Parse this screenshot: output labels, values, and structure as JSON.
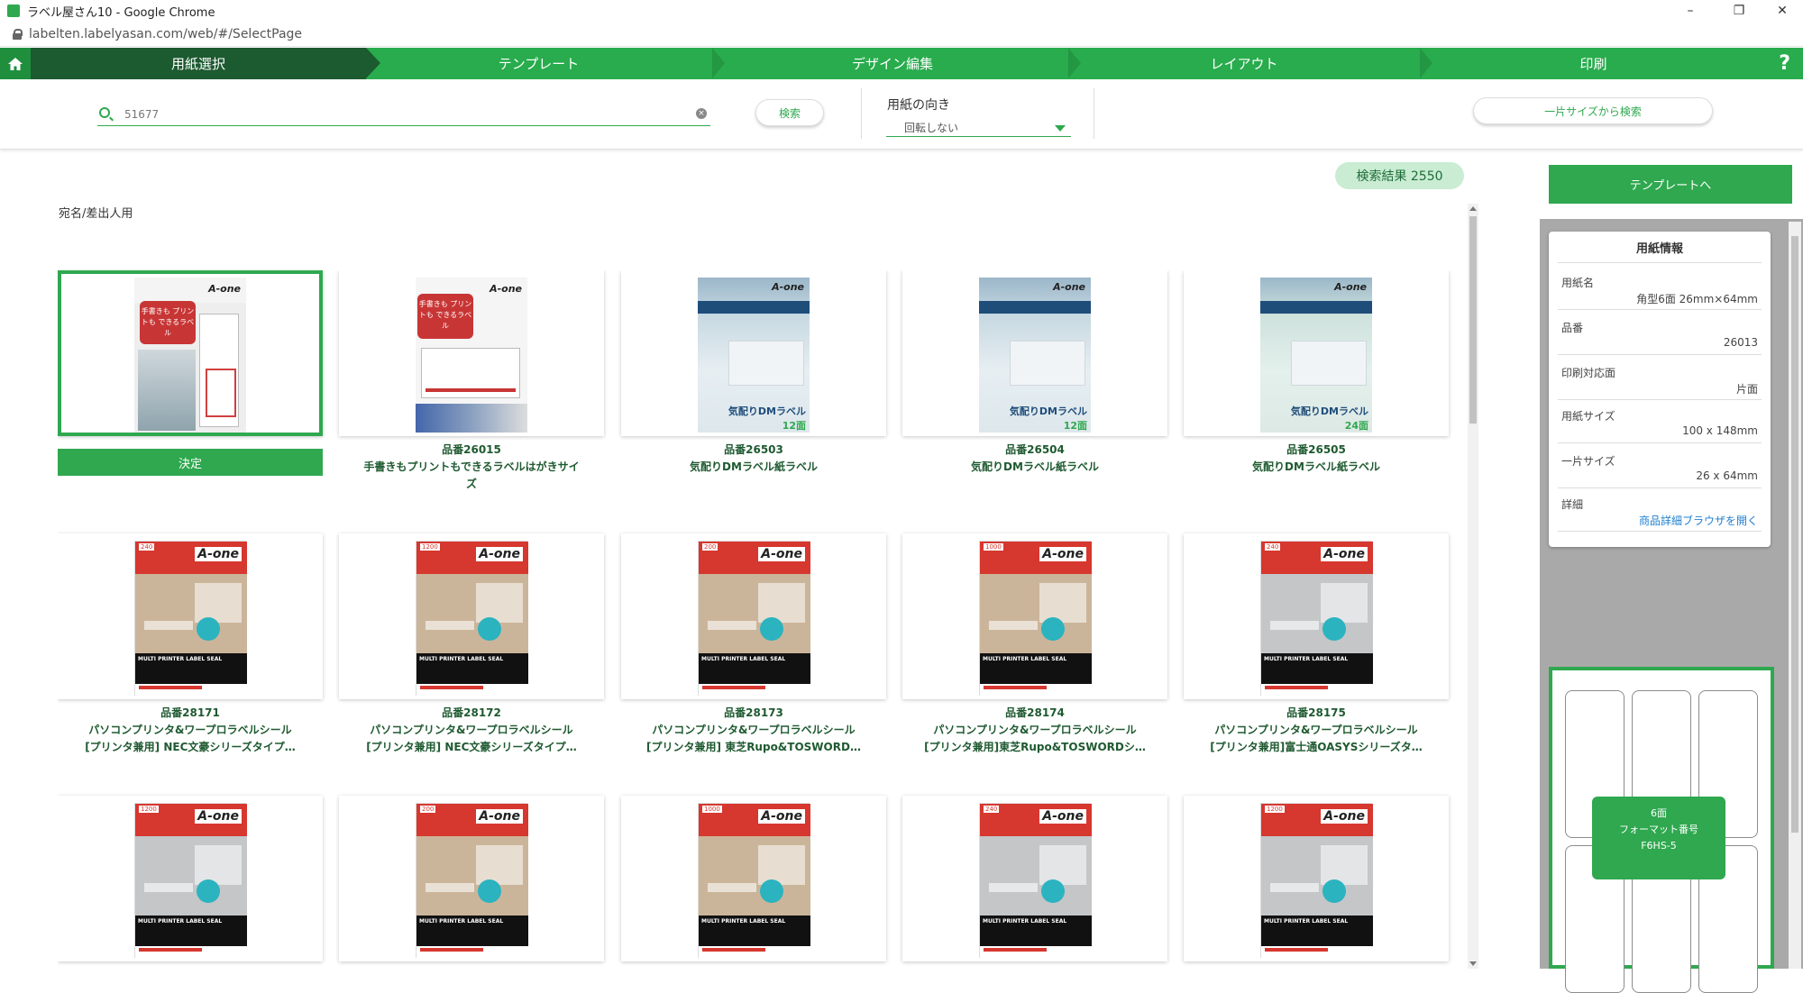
{
  "browser": {
    "window_title": "ラベル屋さん10 - Google Chrome",
    "url": "labelten.labelyasan.com/web/#/SelectPage"
  },
  "steps": [
    {
      "label": "用紙選択",
      "active": true
    },
    {
      "label": "テンプレート",
      "active": false
    },
    {
      "label": "デザイン編集",
      "active": false
    },
    {
      "label": "レイアウト",
      "active": false
    },
    {
      "label": "印刷",
      "active": false
    }
  ],
  "help_label": "?",
  "search": {
    "value": "51677",
    "button_label": "検索",
    "orientation_label": "用紙の向き",
    "orientation_value": "回転しない",
    "size_search_label": "一片サイズから検索"
  },
  "results": {
    "badge": "検索結果 2550",
    "section_title": "宛名/差出人用",
    "decide_label": "決定"
  },
  "products": [
    {
      "code": "",
      "name": [],
      "art": "a",
      "selected": true
    },
    {
      "code": "品番26015",
      "name": [
        "手書きもプリントもできるラベルはがきサイ",
        "ズ"
      ],
      "art": "b"
    },
    {
      "code": "品番26503",
      "name": [
        "気配りDMラベル紙ラベル"
      ],
      "art": "c",
      "pm": "12面"
    },
    {
      "code": "品番26504",
      "name": [
        "気配りDMラベル紙ラベル"
      ],
      "art": "c",
      "pm": "12面"
    },
    {
      "code": "品番26505",
      "name": [
        "気配りDMラベル紙ラベル"
      ],
      "art": "c2",
      "pm": "24面"
    },
    {
      "code": "品番28171",
      "name": [
        "パソコンプリンタ&ワープロラベルシール",
        "[プリンタ兼用] NEC文豪シリーズタイプ…"
      ],
      "art": "d",
      "num": "240"
    },
    {
      "code": "品番28172",
      "name": [
        "パソコンプリンタ&ワープロラベルシール",
        "[プリンタ兼用] NEC文豪シリーズタイプ…"
      ],
      "art": "d",
      "num": "1200"
    },
    {
      "code": "品番28173",
      "name": [
        "パソコンプリンタ&ワープロラベルシール",
        "[プリンタ兼用] 東芝Rupo&TOSWORD…"
      ],
      "art": "d",
      "num": "200"
    },
    {
      "code": "品番28174",
      "name": [
        "パソコンプリンタ&ワープロラベルシール",
        "[プリンタ兼用]東芝Rupo&TOSWORDシ…"
      ],
      "art": "d",
      "num": "1000"
    },
    {
      "code": "品番28175",
      "name": [
        "パソコンプリンタ&ワープロラベルシール",
        "[プリンタ兼用]富士通OASYSシリーズタ…"
      ],
      "art": "d2",
      "num": "240"
    },
    {
      "code": "",
      "name": [],
      "art": "d2",
      "num": "1200"
    },
    {
      "code": "",
      "name": [],
      "art": "d",
      "num": "200"
    },
    {
      "code": "",
      "name": [],
      "art": "d",
      "num": "1000"
    },
    {
      "code": "",
      "name": [],
      "art": "d2",
      "num": "240"
    },
    {
      "code": "",
      "name": [],
      "art": "d2",
      "num": "1200"
    }
  ],
  "art_text": {
    "logo": "A-one",
    "badge": "手書きも プリントも できるラベル",
    "product_title": "気配りDMラベル",
    "multi_printer": "MULTI PRINTER LABEL SEAL"
  },
  "right": {
    "to_template_label": "テンプレートへ",
    "info_title": "用紙情報",
    "fields": [
      {
        "key": "用紙名",
        "value": "角型6面 26mm×64mm"
      },
      {
        "key": "品番",
        "value": "26013"
      },
      {
        "key": "印刷対応面",
        "value": "片面"
      },
      {
        "key": "用紙サイズ",
        "value": "100 x 148mm"
      },
      {
        "key": "一片サイズ",
        "value": "26 x 64mm"
      }
    ],
    "detail_key": "詳細",
    "detail_link": "商品詳細ブラウザを開く",
    "preview_lines": [
      "6面",
      "フォーマット番号",
      "F6HS-5"
    ]
  },
  "colors": {
    "accent": "#2fa84f",
    "step_active": "#1c5a30",
    "panel_gray": "#a9a9a9"
  }
}
